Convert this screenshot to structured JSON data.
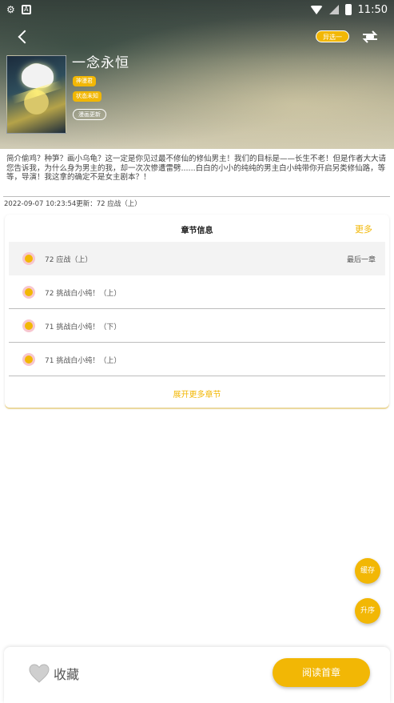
{
  "status_bar": {
    "time": "11:50",
    "left_icons": [
      "bug-icon",
      "a-icon"
    ],
    "right_icons": [
      "wifi-icon",
      "signal-icon",
      "battery-icon"
    ],
    "left_glyph_1": "⚙",
    "left_glyph_2": "A"
  },
  "header": {
    "source_label": "异选一",
    "switch_icon": "switch-source-icon"
  },
  "comic": {
    "title": "一念永恒",
    "author_tag": "神漫君",
    "status_tag": "状态未知",
    "update_tag": "漫画更新"
  },
  "description": "简介偷鸡？种笋？画小乌龟？这一定是你见过最不修仙的修仙男主！我们的目标是——长生不老！但是作者大大请您告诉我，为什么身为男主的我，却一次次惨遭雷劈......白白的小小的纯纯的男主白小纯带你开启另类修仙路，等等，导演！我这拿的确定不是女主剧本？！",
  "update_info": "2022-09-07 10:23:54更新：72 应战（上）",
  "chapters_card": {
    "title": "章节信息",
    "more": "更多",
    "latest_label": "最后一章",
    "items": [
      {
        "name": "72 应战（上）"
      },
      {
        "name": "72 挑战白小纯！（上）"
      },
      {
        "name": "71 挑战白小纯！（下）"
      },
      {
        "name": "71 挑战白小纯！（上）"
      }
    ],
    "expand": "展开更多章节"
  },
  "fabs": {
    "cache": "缓存",
    "sort": "升序"
  },
  "bottom": {
    "favorite": "收藏",
    "read_first": "阅读首章"
  },
  "colors": {
    "accent": "#f2b705",
    "dot_bg": "#f7c6cf"
  }
}
